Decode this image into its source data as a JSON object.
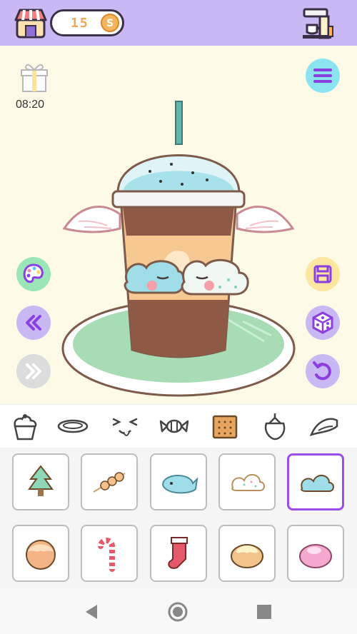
{
  "header": {
    "coins": "15",
    "coin_symbol": "S",
    "icons": [
      "shop-icon",
      "coin-icon",
      "coffee-machine-icon"
    ]
  },
  "stage": {
    "timer": "08:20",
    "left_buttons": [
      "palette-icon",
      "undo-all-icon",
      "redo-all-icon"
    ],
    "right_buttons": [
      "menu-icon",
      "save-icon",
      "dice-icon",
      "undo-icon"
    ],
    "drink_parts": [
      "straw",
      "whipped-cream-dome",
      "cloud-toppers",
      "angel-wings",
      "mint-plate"
    ]
  },
  "categories": {
    "items": [
      "cupcake-icon",
      "plate-icon",
      "face-icon",
      "candy-icon",
      "cracker-icon",
      "strawberry-icon",
      "wing-icon"
    ]
  },
  "palette": {
    "items": [
      {
        "name": "pine-tree-topping"
      },
      {
        "name": "dango-skewer-topping"
      },
      {
        "name": "whale-topping"
      },
      {
        "name": "sprinkle-cloud-topping"
      },
      {
        "name": "blue-cloud-topping",
        "selected": true
      },
      {
        "name": "caramel-ball-topping"
      },
      {
        "name": "candy-cane-topping"
      },
      {
        "name": "stocking-topping"
      },
      {
        "name": "cream-bun-topping"
      },
      {
        "name": "pink-mochi-topping"
      }
    ]
  },
  "colors": {
    "header_bg": "#c9b8f4",
    "stage_bg": "#fdfae8",
    "accent_purple": "#9a4de8",
    "plate_mint": "#a8dcb4",
    "coin_orange": "#f1a55b"
  }
}
